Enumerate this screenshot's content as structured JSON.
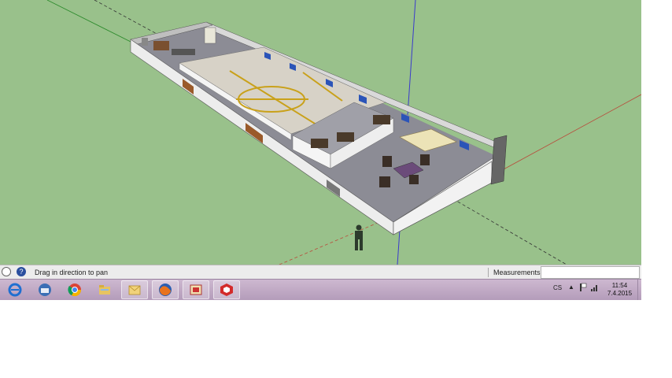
{
  "statusbar": {
    "hint": "Drag in direction to pan",
    "measurements_label": "Measurements",
    "measurements_value": "",
    "icons": [
      "user-icon",
      "help-icon"
    ]
  },
  "taskbar": {
    "apps": [
      "internet-explorer-icon",
      "network-icon",
      "chrome-icon",
      "file-explorer-icon",
      "email-icon",
      "firefox-icon",
      "app-icon",
      "sketchup-icon"
    ],
    "language": "CS",
    "clock_time": "11:54",
    "clock_date": "7.4.2015"
  },
  "colors": {
    "sky_ground": "#99c18b",
    "taskbar": "#c3adc7",
    "axis_blue": "#3333cc",
    "axis_red": "#b94a3a",
    "axis_green": "#2c8a2c"
  }
}
